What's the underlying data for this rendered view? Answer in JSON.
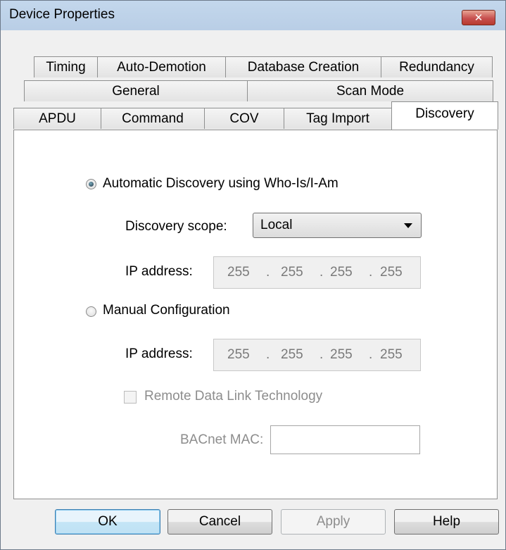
{
  "window": {
    "title": "Device Properties",
    "close_glyph": "✕"
  },
  "tabs": {
    "row1": [
      "Timing",
      "Auto-Demotion",
      "Database Creation",
      "Redundancy"
    ],
    "row2": [
      "General",
      "Scan Mode"
    ],
    "row3": [
      "APDU",
      "Command",
      "COV",
      "Tag Import",
      "Discovery"
    ],
    "active": "Discovery"
  },
  "discovery": {
    "auto_option": {
      "label": "Automatic Discovery using Who-Is/I-Am",
      "selected": true
    },
    "scope": {
      "label": "Discovery scope:",
      "value": "Local"
    },
    "auto_ip": {
      "label": "IP address:",
      "octets": [
        "255",
        "255",
        "255",
        "255"
      ]
    },
    "manual_option": {
      "label": "Manual Configuration",
      "selected": false
    },
    "manual_ip": {
      "label": "IP address:",
      "octets": [
        "255",
        "255",
        "255",
        "255"
      ]
    },
    "remote_link": {
      "label": "Remote Data Link Technology",
      "checked": false
    },
    "bacnet_mac": {
      "label": "BACnet MAC:",
      "value": ""
    },
    "ip_separator": "."
  },
  "buttons": {
    "ok": "OK",
    "cancel": "Cancel",
    "apply": "Apply",
    "help": "Help"
  },
  "icons": {
    "close": "close-icon",
    "dropdown": "chevron-down-icon"
  }
}
